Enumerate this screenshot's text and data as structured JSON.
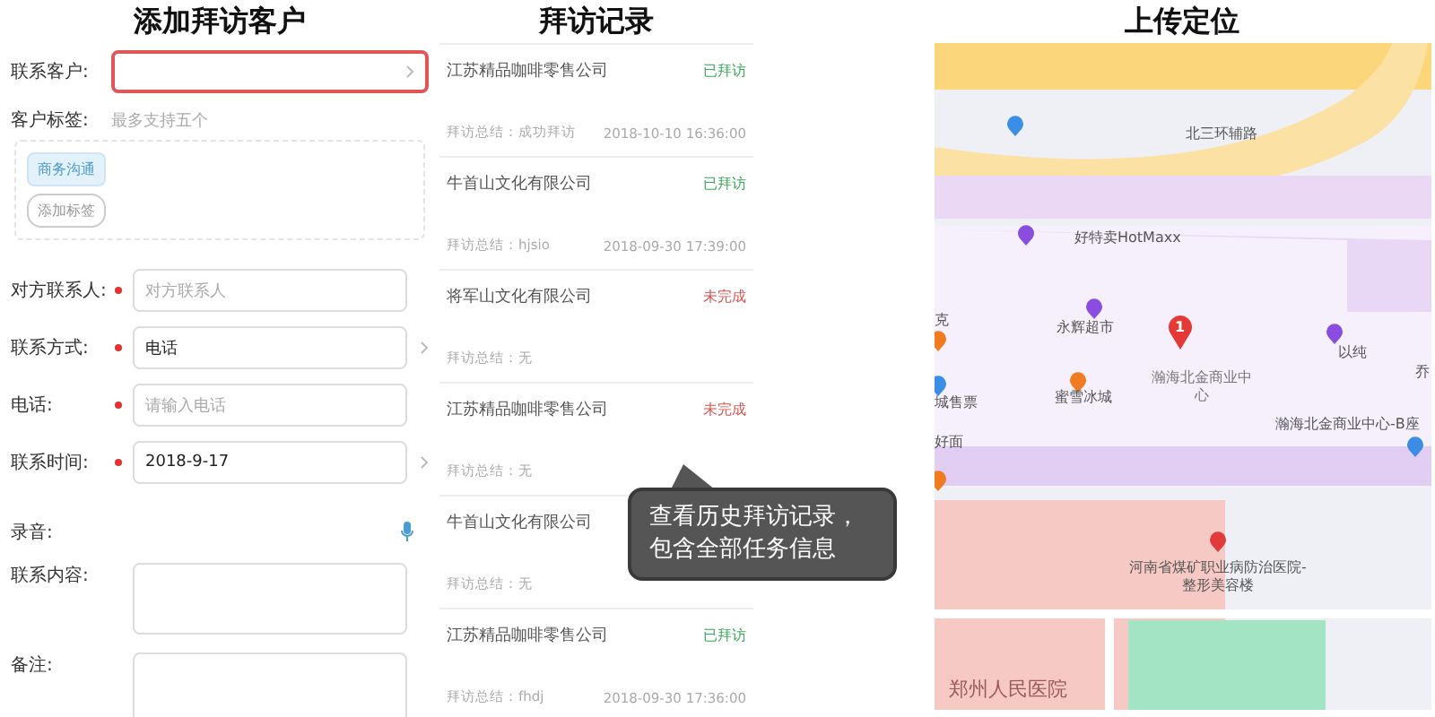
{
  "panels": {
    "form_title": "添加拜访客户",
    "records_title": "拜访记录",
    "map_title": "上传定位"
  },
  "customer": {
    "label": "联系客户:",
    "highlighted": true
  },
  "tags": {
    "label": "客户标签:",
    "hint": "最多支持五个",
    "items": [
      {
        "label": "商务沟通",
        "selected": true
      },
      {
        "label": "添加标签",
        "selected": false
      }
    ]
  },
  "contact_fields": [
    {
      "label": "对方联系人:",
      "required": true,
      "kind": "input",
      "placeholder": "对方联系人"
    },
    {
      "label": "联系方式:",
      "required": true,
      "kind": "select",
      "value": "电话"
    },
    {
      "label": "电话:",
      "required": true,
      "kind": "input",
      "placeholder": "请输入电话"
    },
    {
      "label": "联系时间:",
      "required": true,
      "kind": "select",
      "value": "2018-9-17"
    }
  ],
  "recording": {
    "label": "录音:"
  },
  "text_fields": [
    {
      "label": "联系内容:"
    },
    {
      "label": "备注:"
    }
  ],
  "records": [
    {
      "company": "江苏精品咖啡零售公司",
      "status": "已拜访",
      "kind": "done",
      "summary": "拜访总结：成功拜访",
      "time": "2018-10-10 16:36:00"
    },
    {
      "company": "牛首山文化有限公司",
      "status": "已拜访",
      "kind": "done",
      "summary": "拜访总结：hjsio",
      "time": "2018-09-30 17:39:00"
    },
    {
      "company": "将军山文化有限公司",
      "status": "未完成",
      "kind": "pending",
      "summary": "拜访总结：无"
    },
    {
      "company": "江苏精品咖啡零售公司",
      "status": "未完成",
      "kind": "pending",
      "summary": "拜访总结：无"
    },
    {
      "company": "牛首山文化有限公司",
      "summary": "拜访总结：无"
    },
    {
      "company": "江苏精品咖啡零售公司",
      "status": "已拜访",
      "kind": "done",
      "summary": "拜访总结：fhdj",
      "time": "2018-09-30 17:36:00"
    }
  ],
  "tooltip": {
    "text": "查看历史拜访记录，包含全部任务信息"
  },
  "map_labels": [
    {
      "text": "北三环辅路",
      "kind": "road"
    },
    {
      "text": "好特卖HotMaxx",
      "kind": "poi"
    },
    {
      "text": "克",
      "kind": "poi"
    },
    {
      "text": "永辉超市",
      "kind": "poi"
    },
    {
      "text": "瀚海北金商业中心",
      "kind": "main"
    },
    {
      "text": "以纯",
      "kind": "poi"
    },
    {
      "text": "乔",
      "kind": "poi"
    },
    {
      "text": "城售票",
      "kind": "poi"
    },
    {
      "text": "蜜雪冰城",
      "kind": "poi"
    },
    {
      "text": "瀚海北金商业中心-B座",
      "kind": "poi"
    },
    {
      "text": "好面",
      "kind": "poi"
    },
    {
      "text": "河南省煤矿职业病防治医院-整形美容楼",
      "kind": "poi"
    },
    {
      "text": "郑州人民医院",
      "kind": "area"
    }
  ],
  "map_pin": {
    "label": "1"
  }
}
